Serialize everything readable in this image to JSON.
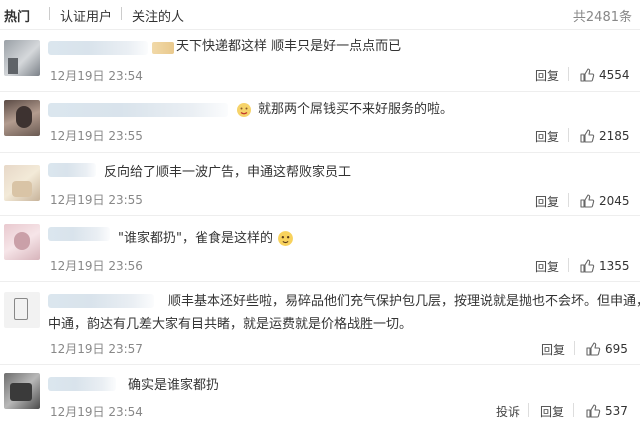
{
  "tabs": [
    {
      "label": "热门",
      "active": true
    },
    {
      "label": "认证用户",
      "active": false
    },
    {
      "label": "关注的人",
      "active": false
    }
  ],
  "total_label": "共2481条",
  "icons": {
    "like": "thumbs-up-icon",
    "emoji": "smiley-emoji-icon"
  },
  "colors": {
    "text": "#333333",
    "meta": "#888888",
    "divider": "#eeeeee"
  },
  "comments": [
    {
      "text": "天下快递都这样 顺丰只是好一点点而已",
      "time": "12月19日 23:54",
      "action": "回复",
      "likes": "4554"
    },
    {
      "text": "就那两个屌钱买不来好服务的啦。",
      "time": "12月19日 23:55",
      "action": "回复",
      "likes": "2185"
    },
    {
      "text": "反向给了顺丰一波广告，申通这帮败家员工",
      "time": "12月19日 23:55",
      "action": "回复",
      "likes": "2045"
    },
    {
      "text": "\"谁家都扔\"，雀食是这样的",
      "time": "12月19日 23:56",
      "action": "回复",
      "likes": "1355"
    },
    {
      "text_lines": [
        "顺丰基本还好些啦，易碎品他们充气保护包几层，按理说就是抛也不会坏。但申通，",
        "中通，韵达有几差大家有目共睹，就是运费就是价格战胜一切。"
      ],
      "time": "12月19日 23:57",
      "action": "回复",
      "likes": "695"
    },
    {
      "text": "确实是谁家都扔",
      "time": "12月19日 23:54",
      "action": "投诉",
      "action2": "回复",
      "likes": "537"
    }
  ]
}
